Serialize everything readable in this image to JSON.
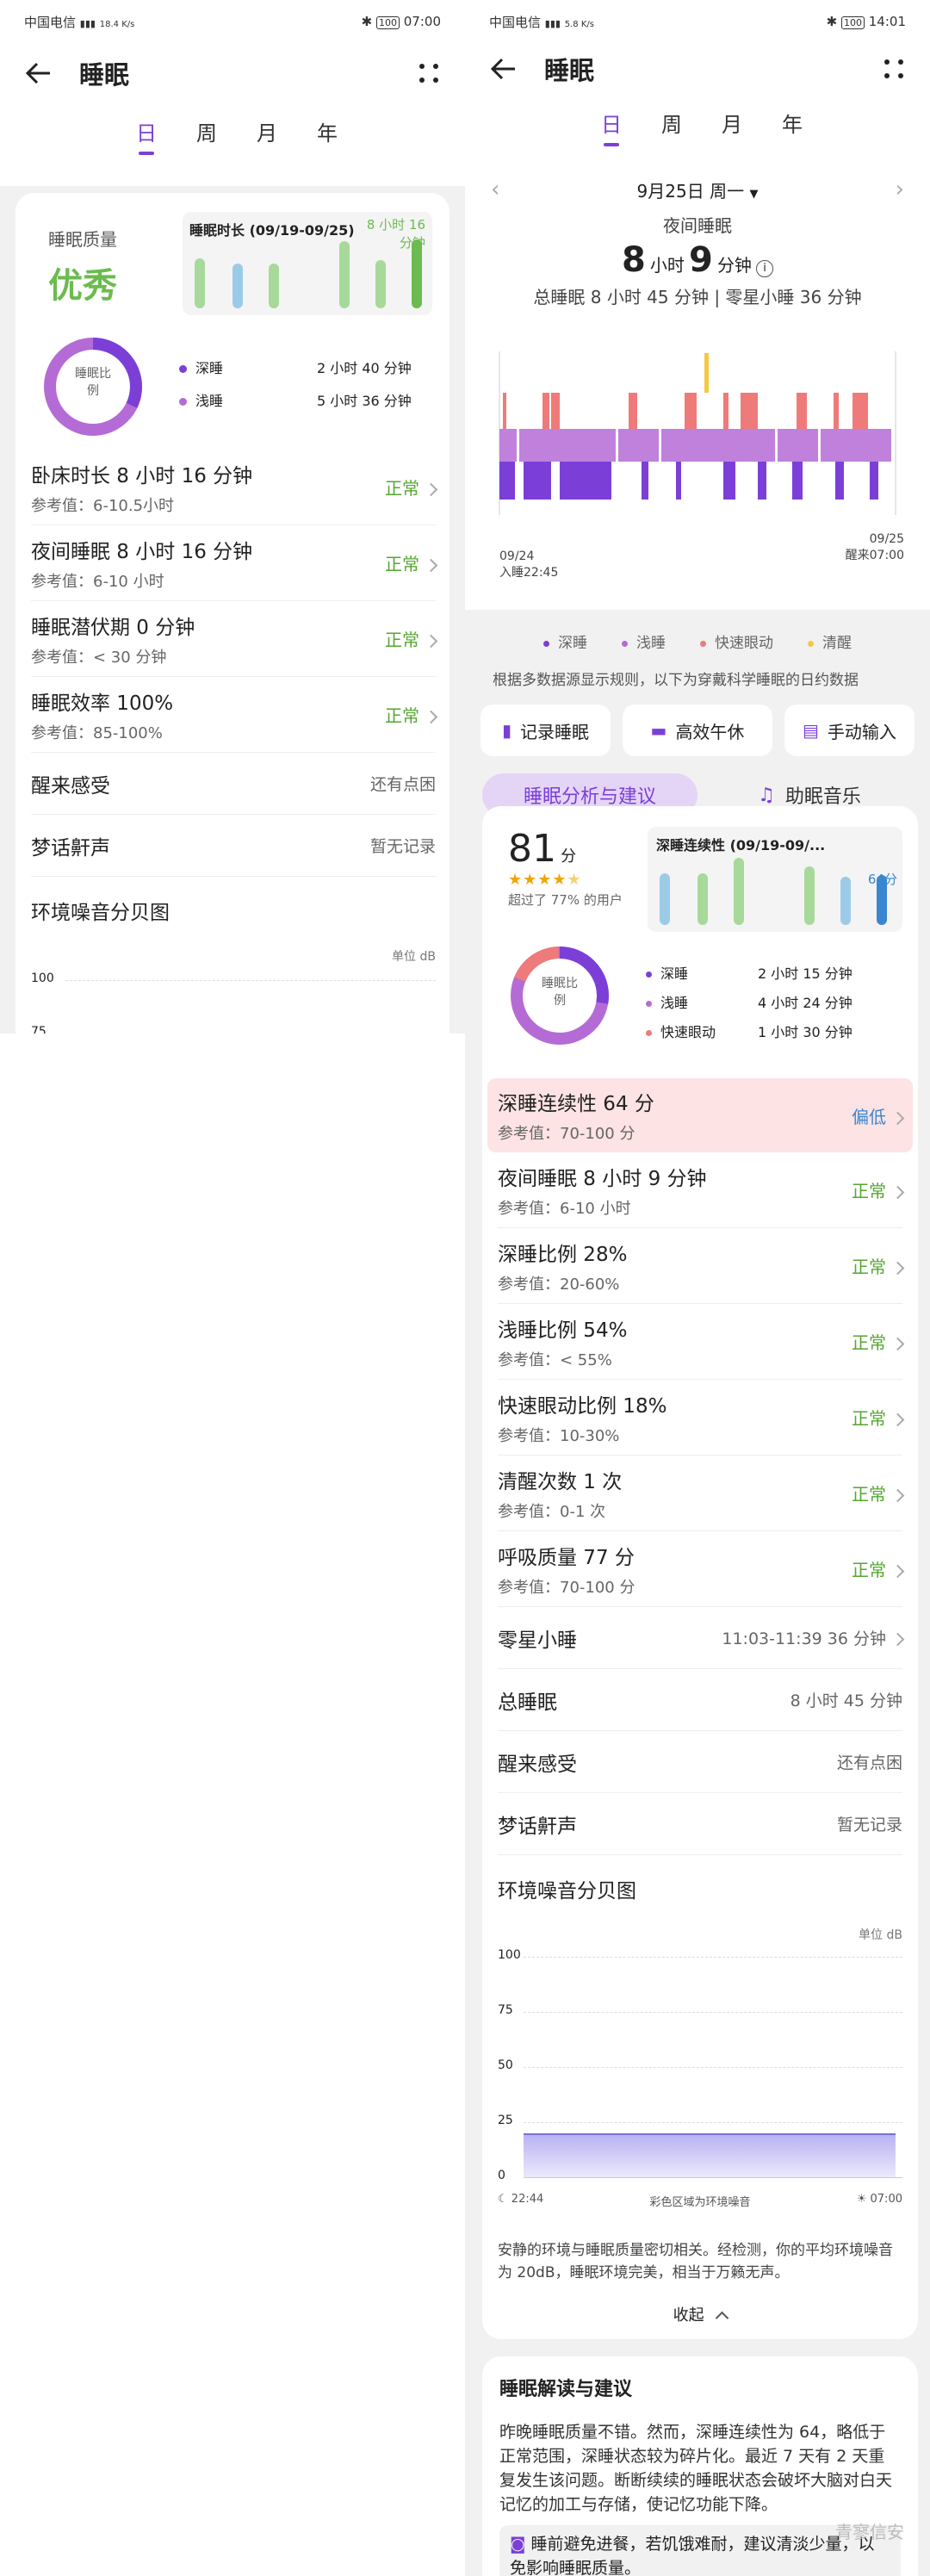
{
  "left": {
    "status": {
      "carrier": "中国电信",
      "speed": "18.4 K/s",
      "battery": "100",
      "time": "07:00"
    },
    "header": {
      "title": "睡眠"
    },
    "tabs": [
      "日",
      "周",
      "月",
      "年"
    ],
    "quality": {
      "label": "睡眠质量",
      "value": "优秀"
    },
    "mini_chart": {
      "title": "睡眠时长 (09/19-09/25)",
      "value": "8 小时 16 分钟"
    },
    "donut": {
      "center": "睡眠比例",
      "legend": [
        {
          "name": "深睡",
          "value": "2 小时 40 分钟"
        },
        {
          "name": "浅睡",
          "value": "5 小时 36 分钟"
        }
      ]
    },
    "metrics": [
      {
        "title": "卧床时长  8 小时 16 分钟",
        "ref": "参考值：6-10.5小时",
        "status": "正常"
      },
      {
        "title": "夜间睡眠  8 小时 16 分钟",
        "ref": "参考值：6-10 小时",
        "status": "正常"
      },
      {
        "title": "睡眠潜伏期 0 分钟",
        "ref": "参考值：< 30 分钟",
        "status": "正常"
      },
      {
        "title": "睡眠效率  100%",
        "ref": "参考值：85-100%",
        "status": "正常"
      }
    ],
    "simple": [
      {
        "label": "醒来感受",
        "value": "还有点困"
      },
      {
        "label": "梦话鼾声",
        "value": "暂无记录"
      }
    ],
    "noise": {
      "title": "环境噪音分贝图",
      "unit": "单位 dB",
      "ticks": [
        "100",
        "75"
      ]
    }
  },
  "right": {
    "status": {
      "carrier": "中国电信",
      "speed": "5.8 K/s",
      "battery": "100",
      "time": "14:01"
    },
    "header": {
      "title": "睡眠"
    },
    "tabs": [
      "日",
      "周",
      "月",
      "年"
    ],
    "date": "9月25日 周一",
    "night": {
      "label": "夜间睡眠",
      "hours": "8",
      "hours_unit": "小时",
      "mins": "9",
      "mins_unit": "分钟"
    },
    "total_line": "总睡眠 8 小时 45 分钟 | 零星小睡 36 分钟",
    "timeline": {
      "start_date": "09/24",
      "start_label": "入睡22:45",
      "end_date": "09/25",
      "end_label": "醒来07:00"
    },
    "legend": [
      {
        "name": "深睡",
        "color": "#7b3fd8"
      },
      {
        "name": "浅睡",
        "color": "#b46bd6"
      },
      {
        "name": "快速眼动",
        "color": "#ef7a7a"
      },
      {
        "name": "清醒",
        "color": "#f5c842"
      }
    ],
    "note": "根据多数据源显示规则，以下为穿戴科学睡眠的日约数据",
    "actions": [
      "记录睡眠",
      "高效午休",
      "手动输入"
    ],
    "seg_tabs": [
      "睡眠分析与建议",
      "助眠音乐"
    ],
    "score": {
      "value": "81",
      "unit": "分",
      "stars": 4.5,
      "beat": "超过了 77% 的用户"
    },
    "mini_chart": {
      "title": "深睡连续性 (09/19-09/...",
      "value": "64分"
    },
    "donut": {
      "center": "睡眠比例",
      "legend": [
        {
          "name": "深睡",
          "value": "2 小时 15 分钟"
        },
        {
          "name": "浅睡",
          "value": "4 小时 24 分钟"
        },
        {
          "name": "快速眼动",
          "value": "1 小时 30 分钟"
        }
      ]
    },
    "metrics": [
      {
        "title": "深睡连续性  64 分",
        "ref": "参考值：70-100 分",
        "status": "偏低",
        "highlight": true
      },
      {
        "title": "夜间睡眠  8 小时 9 分钟",
        "ref": "参考值：6-10 小时",
        "status": "正常"
      },
      {
        "title": "深睡比例  28%",
        "ref": "参考值：20-60%",
        "status": "正常"
      },
      {
        "title": "浅睡比例  54%",
        "ref": "参考值：< 55%",
        "status": "正常"
      },
      {
        "title": "快速眼动比例  18%",
        "ref": "参考值：10-30%",
        "status": "正常"
      },
      {
        "title": "清醒次数  1 次",
        "ref": "参考值：0-1 次",
        "status": "正常"
      },
      {
        "title": "呼吸质量  77 分",
        "ref": "参考值：70-100 分",
        "status": "正常"
      }
    ],
    "simple": [
      {
        "label": "零星小睡",
        "value": "11:03-11:39   36 分钟",
        "chev": true
      },
      {
        "label": "总睡眠",
        "value": "8 小时 45 分钟"
      },
      {
        "label": "醒来感受",
        "value": "还有点困"
      },
      {
        "label": "梦话鼾声",
        "value": "暂无记录"
      }
    ],
    "noise": {
      "title": "环境噪音分贝图",
      "unit": "单位 dB",
      "ticks": [
        "100",
        "75",
        "50",
        "25",
        "0"
      ],
      "start": "22:44",
      "mid": "彩色区域为环境噪音",
      "end": "07:00",
      "avg_db": 20,
      "desc": "安静的环境与睡眠质量密切相关。经检测，你的平均环境噪音为 20dB，睡眠环境完美，相当于万籁无声。",
      "collapse": "收起"
    },
    "advice": {
      "title": "睡眠解读与建议",
      "p1": "昨晚睡眠质量不错。然而，深睡连续性为 64，略低于正常范围，深睡状态较为碎片化。最近 7 天有 2 天重复发生该问题。断断续续的睡眠状态会破坏大脑对白天记忆的加工与存储，使记忆功能下降。",
      "tip": "睡前避免进餐，若饥饿难耐，建议清淡少量，以免影响睡眠质量。"
    },
    "watermark": "青寥信安"
  }
}
